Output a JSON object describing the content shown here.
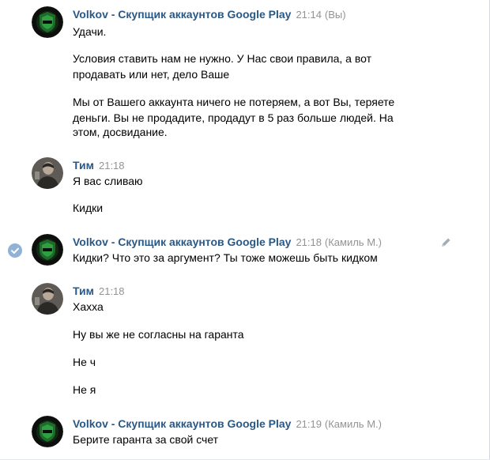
{
  "messages": [
    {
      "author": "Volkov - Скупщик аккаунтов Google Play",
      "time": "21:14",
      "sender": "(Вы)",
      "lines": [
        "Удачи.",
        "Условия ставить нам не нужно. У Нас свои правила, а вот",
        "продавать или нет, дело Ваше",
        "Мы от Вашего аккаунта ничего не потеряем, а вот Вы, теряете",
        "деньги. Вы не продадите, продадут в 5 раз больше людей. На",
        "этом, досвидание."
      ]
    },
    {
      "author": "Тим",
      "time": "21:18",
      "lines": [
        "Я вас сливаю",
        "Кидки"
      ]
    },
    {
      "author": "Volkov - Скупщик аккаунтов Google Play",
      "time": "21:18",
      "sender": "(Камиль М.)",
      "lines": [
        "Кидки? Что это за аргумент? Ты тоже можешь быть кидком"
      ]
    },
    {
      "author": "Тим",
      "time": "21:18",
      "lines": [
        "Хахха",
        "Ну вы же не согласны на гаранта",
        "Не ч",
        "Не я"
      ]
    },
    {
      "author": "Volkov - Скупщик аккаунтов Google Play",
      "time": "21:19",
      "sender": "(Камиль М.)",
      "lines": [
        "Берите гаранта за свой счет"
      ]
    }
  ],
  "icons": {
    "selected": "check-circle-icon",
    "edit": "pencil-icon",
    "volkov_avatar": "green-shield-logo",
    "tim_avatar": "user-photo"
  },
  "colors": {
    "author": "#2a5885",
    "time": "#939393",
    "text": "#000000",
    "check": "#8fb2d6"
  }
}
